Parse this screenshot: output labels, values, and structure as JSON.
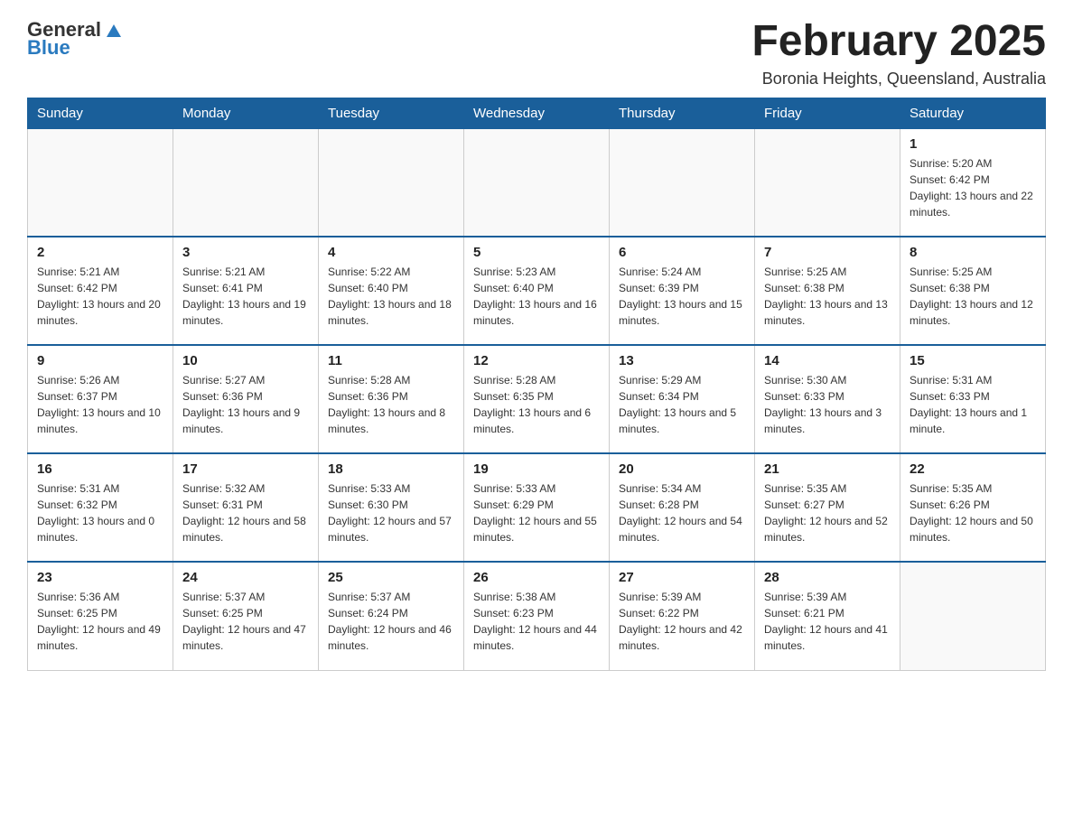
{
  "header": {
    "logo_general": "General",
    "logo_blue": "Blue",
    "title": "February 2025",
    "location": "Boronia Heights, Queensland, Australia"
  },
  "days_of_week": [
    "Sunday",
    "Monday",
    "Tuesday",
    "Wednesday",
    "Thursday",
    "Friday",
    "Saturday"
  ],
  "weeks": [
    [
      {
        "day": "",
        "info": ""
      },
      {
        "day": "",
        "info": ""
      },
      {
        "day": "",
        "info": ""
      },
      {
        "day": "",
        "info": ""
      },
      {
        "day": "",
        "info": ""
      },
      {
        "day": "",
        "info": ""
      },
      {
        "day": "1",
        "info": "Sunrise: 5:20 AM\nSunset: 6:42 PM\nDaylight: 13 hours and 22 minutes."
      }
    ],
    [
      {
        "day": "2",
        "info": "Sunrise: 5:21 AM\nSunset: 6:42 PM\nDaylight: 13 hours and 20 minutes."
      },
      {
        "day": "3",
        "info": "Sunrise: 5:21 AM\nSunset: 6:41 PM\nDaylight: 13 hours and 19 minutes."
      },
      {
        "day": "4",
        "info": "Sunrise: 5:22 AM\nSunset: 6:40 PM\nDaylight: 13 hours and 18 minutes."
      },
      {
        "day": "5",
        "info": "Sunrise: 5:23 AM\nSunset: 6:40 PM\nDaylight: 13 hours and 16 minutes."
      },
      {
        "day": "6",
        "info": "Sunrise: 5:24 AM\nSunset: 6:39 PM\nDaylight: 13 hours and 15 minutes."
      },
      {
        "day": "7",
        "info": "Sunrise: 5:25 AM\nSunset: 6:38 PM\nDaylight: 13 hours and 13 minutes."
      },
      {
        "day": "8",
        "info": "Sunrise: 5:25 AM\nSunset: 6:38 PM\nDaylight: 13 hours and 12 minutes."
      }
    ],
    [
      {
        "day": "9",
        "info": "Sunrise: 5:26 AM\nSunset: 6:37 PM\nDaylight: 13 hours and 10 minutes."
      },
      {
        "day": "10",
        "info": "Sunrise: 5:27 AM\nSunset: 6:36 PM\nDaylight: 13 hours and 9 minutes."
      },
      {
        "day": "11",
        "info": "Sunrise: 5:28 AM\nSunset: 6:36 PM\nDaylight: 13 hours and 8 minutes."
      },
      {
        "day": "12",
        "info": "Sunrise: 5:28 AM\nSunset: 6:35 PM\nDaylight: 13 hours and 6 minutes."
      },
      {
        "day": "13",
        "info": "Sunrise: 5:29 AM\nSunset: 6:34 PM\nDaylight: 13 hours and 5 minutes."
      },
      {
        "day": "14",
        "info": "Sunrise: 5:30 AM\nSunset: 6:33 PM\nDaylight: 13 hours and 3 minutes."
      },
      {
        "day": "15",
        "info": "Sunrise: 5:31 AM\nSunset: 6:33 PM\nDaylight: 13 hours and 1 minute."
      }
    ],
    [
      {
        "day": "16",
        "info": "Sunrise: 5:31 AM\nSunset: 6:32 PM\nDaylight: 13 hours and 0 minutes."
      },
      {
        "day": "17",
        "info": "Sunrise: 5:32 AM\nSunset: 6:31 PM\nDaylight: 12 hours and 58 minutes."
      },
      {
        "day": "18",
        "info": "Sunrise: 5:33 AM\nSunset: 6:30 PM\nDaylight: 12 hours and 57 minutes."
      },
      {
        "day": "19",
        "info": "Sunrise: 5:33 AM\nSunset: 6:29 PM\nDaylight: 12 hours and 55 minutes."
      },
      {
        "day": "20",
        "info": "Sunrise: 5:34 AM\nSunset: 6:28 PM\nDaylight: 12 hours and 54 minutes."
      },
      {
        "day": "21",
        "info": "Sunrise: 5:35 AM\nSunset: 6:27 PM\nDaylight: 12 hours and 52 minutes."
      },
      {
        "day": "22",
        "info": "Sunrise: 5:35 AM\nSunset: 6:26 PM\nDaylight: 12 hours and 50 minutes."
      }
    ],
    [
      {
        "day": "23",
        "info": "Sunrise: 5:36 AM\nSunset: 6:25 PM\nDaylight: 12 hours and 49 minutes."
      },
      {
        "day": "24",
        "info": "Sunrise: 5:37 AM\nSunset: 6:25 PM\nDaylight: 12 hours and 47 minutes."
      },
      {
        "day": "25",
        "info": "Sunrise: 5:37 AM\nSunset: 6:24 PM\nDaylight: 12 hours and 46 minutes."
      },
      {
        "day": "26",
        "info": "Sunrise: 5:38 AM\nSunset: 6:23 PM\nDaylight: 12 hours and 44 minutes."
      },
      {
        "day": "27",
        "info": "Sunrise: 5:39 AM\nSunset: 6:22 PM\nDaylight: 12 hours and 42 minutes."
      },
      {
        "day": "28",
        "info": "Sunrise: 5:39 AM\nSunset: 6:21 PM\nDaylight: 12 hours and 41 minutes."
      },
      {
        "day": "",
        "info": ""
      }
    ]
  ]
}
